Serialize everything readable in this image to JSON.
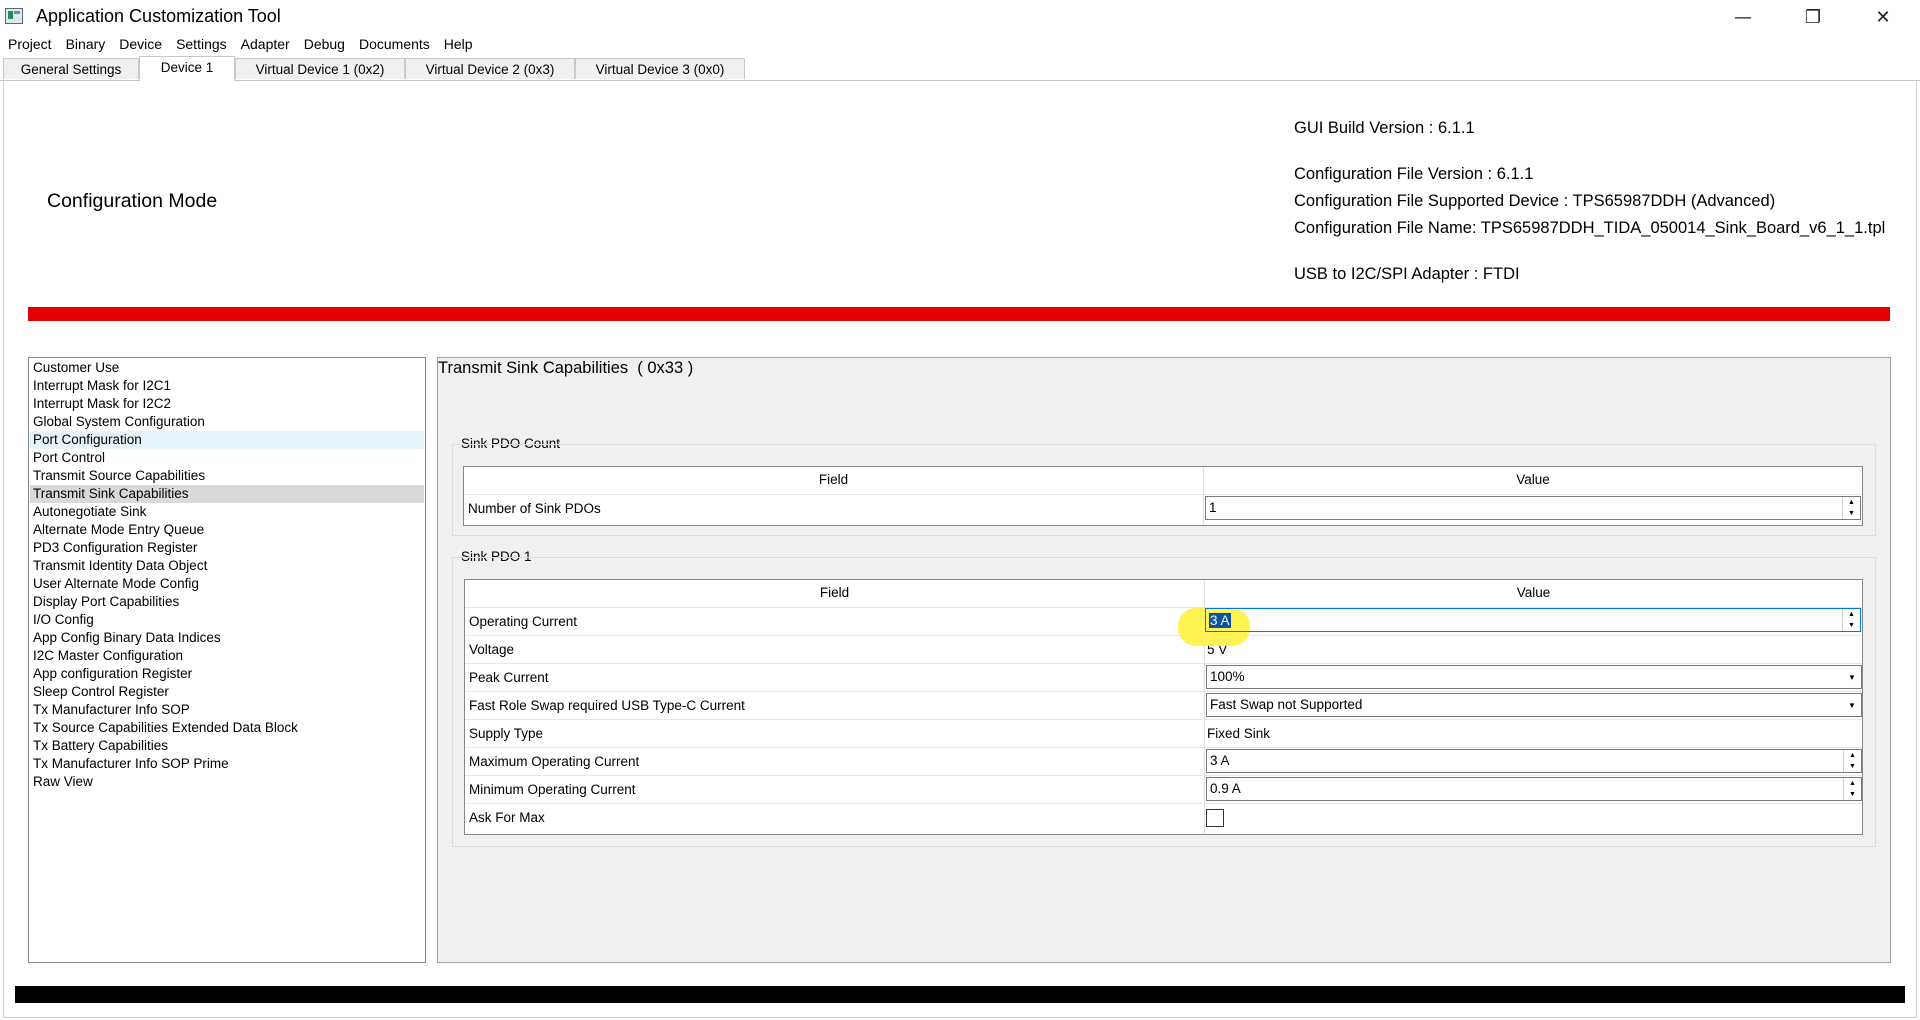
{
  "window": {
    "title": "Application Customization Tool",
    "minimize_glyph": "—",
    "restore_glyph": "❐",
    "close_glyph": "✕"
  },
  "menu": [
    "Project",
    "Binary",
    "Device",
    "Settings",
    "Adapter",
    "Debug",
    "Documents",
    "Help"
  ],
  "tabs": [
    {
      "label": "General Settings",
      "active": false
    },
    {
      "label": "Device 1",
      "active": true
    },
    {
      "label": "Virtual Device 1 (0x2)",
      "active": false
    },
    {
      "label": "Virtual Device 2 (0x3)",
      "active": false
    },
    {
      "label": "Virtual Device 3 (0x0)",
      "active": false
    }
  ],
  "header": {
    "mode": "Configuration Mode",
    "gui_build": "GUI Build Version : 6.1.1",
    "config_version": "Configuration File Version : 6.1.1",
    "supported_device": "Configuration File Supported Device : TPS65987DDH (Advanced)",
    "file_name": "Configuration File Name: TPS65987DDH_TIDA_050014_Sink_Board_v6_1_1.tpl",
    "adapter": "USB to I2C/SPI Adapter : FTDI"
  },
  "colors": {
    "status_bar": "#e00000",
    "bottom_bar": "#000000",
    "annotation_highlight": "#fff24a"
  },
  "nav": {
    "items": [
      "Customer Use",
      "Interrupt Mask for I2C1",
      "Interrupt Mask for I2C2",
      "Global System Configuration",
      "Port Configuration",
      "Port Control",
      "Transmit Source Capabilities",
      "Transmit Sink Capabilities",
      "Autonegotiate Sink",
      "Alternate Mode Entry Queue",
      "PD3 Configuration Register",
      "Transmit Identity Data Object",
      "User Alternate Mode Config",
      "Display Port Capabilities",
      "I/O Config",
      "App Config Binary Data Indices",
      "I2C Master Configuration",
      "App configuration Register",
      "Sleep Control Register",
      "Tx Manufacturer Info SOP",
      "Tx Source Capabilities Extended Data Block",
      "Tx Battery Capabilities",
      "Tx Manufacturer Info SOP Prime",
      "Raw View"
    ],
    "selected": "Transmit Sink Capabilities",
    "hovered": "Port Configuration"
  },
  "panel": {
    "title": "Transmit Sink Capabilities  ( 0x33 )",
    "field_header": "Field",
    "value_header": "Value",
    "count_group": {
      "label": "Sink PDO Count",
      "rows": [
        {
          "field": "Number of Sink PDOs",
          "value": "1",
          "control": "spinner"
        }
      ]
    },
    "pdo_group": {
      "label": "Sink PDO 1",
      "rows": [
        {
          "field": "Operating Current",
          "value": "3 A",
          "control": "spinner",
          "focused": true
        },
        {
          "field": "Voltage",
          "value": "5 V",
          "control": "text"
        },
        {
          "field": "Peak Current",
          "value": "100%",
          "control": "combo"
        },
        {
          "field": "Fast Role Swap required USB Type-C Current",
          "value": "Fast Swap not Supported",
          "control": "combo"
        },
        {
          "field": "Supply Type",
          "value": "Fixed Sink",
          "control": "text"
        },
        {
          "field": "Maximum Operating Current",
          "value": "3 A",
          "control": "spinner"
        },
        {
          "field": "Minimum Operating Current",
          "value": "0.9 A",
          "control": "spinner"
        },
        {
          "field": "Ask For Max",
          "checked": false,
          "control": "checkbox"
        }
      ]
    }
  }
}
